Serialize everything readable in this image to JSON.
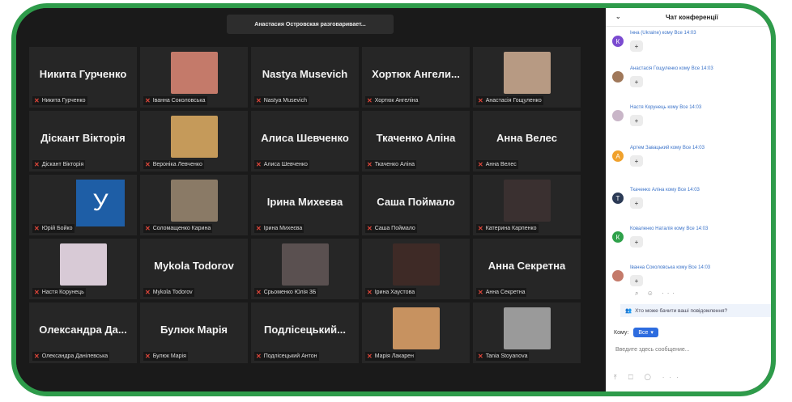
{
  "speaker_banner": "Анастасия Островская разговаривает...",
  "tiles": [
    {
      "big": "Никита Гурченко",
      "label": "Никита Гурченко",
      "type": "name"
    },
    {
      "big": "",
      "label": "Іванна Соколовська",
      "type": "photo",
      "color": "#c47a6a"
    },
    {
      "big": "Nastya Musevich",
      "label": "Nastya Musevich",
      "type": "name"
    },
    {
      "big": "Хортюк Ангели...",
      "label": "Хортюк Ангеліна",
      "type": "name"
    },
    {
      "big": "",
      "label": "Анастасія Гощуленко",
      "type": "photo",
      "color": "#b79a83"
    },
    {
      "big": "Діскант Вікторія",
      "label": "Діскант Вікторія",
      "type": "name"
    },
    {
      "big": "",
      "label": "Вероніка Левченко",
      "type": "photo",
      "color": "#c59a5a"
    },
    {
      "big": "Алиса Шевченко",
      "label": "Алиса Шевченко",
      "type": "name"
    },
    {
      "big": "Ткаченко Аліна",
      "label": "Ткаченко Аліна",
      "type": "name"
    },
    {
      "big": "Анна Велес",
      "label": "Анна Велес",
      "type": "name"
    },
    {
      "big": "",
      "label": "Юрій Бойко",
      "type": "avatar",
      "letter": "У"
    },
    {
      "big": "",
      "label": "Соломащенко Карина",
      "type": "photo",
      "color": "#8a7a66"
    },
    {
      "big": "Ірина Михеєва",
      "label": "Ірина Михеєва",
      "type": "name"
    },
    {
      "big": "Саша Поймало",
      "label": "Саша Поймало",
      "type": "name"
    },
    {
      "big": "",
      "label": "Катерина Карпенко",
      "type": "photo",
      "color": "#3a3030"
    },
    {
      "big": "",
      "label": "Настя Корунець",
      "type": "photo",
      "color": "#d8cad6"
    },
    {
      "big": "Mykola Todorov",
      "label": "Mykola Todorov",
      "type": "name"
    },
    {
      "big": "",
      "label": "Срьоменко Юлія 3Б",
      "type": "photo",
      "color": "#5a5050"
    },
    {
      "big": "",
      "label": "Ірина Хаустова",
      "type": "photo",
      "color": "#3e2a26"
    },
    {
      "big": "Анна Секретна",
      "label": "Анна Секретна",
      "type": "name"
    },
    {
      "big": "Олександра Да...",
      "label": "Олександра Данілевська",
      "type": "name"
    },
    {
      "big": "Булюк Марія",
      "label": "Булюк Марія",
      "type": "name"
    },
    {
      "big": "Подлісецький...",
      "label": "Подлісецький Антон",
      "type": "name"
    },
    {
      "big": "",
      "label": "Марія Лакарен",
      "type": "photo",
      "color": "#c79260"
    },
    {
      "big": "",
      "label": "Tania Stoyanova",
      "type": "photo",
      "color": "#9a9a9a"
    }
  ],
  "chat": {
    "title": "Чат конференції",
    "messages": [
      {
        "who": "Інна (Ukraine) кому Все 14:03",
        "avatar_color": "#7b4bd0",
        "avatar_letter": "К",
        "text": "+"
      },
      {
        "who": "Анастасія Гощуленко кому Все 14:03",
        "avatar_color": "#a0785a",
        "avatar_letter": "",
        "text": "+"
      },
      {
        "who": "Настя Корунець кому Все 14:03",
        "avatar_color": "#c9b6c8",
        "avatar_letter": "",
        "text": "+"
      },
      {
        "who": "Артем Завацький кому Все 14:03",
        "avatar_color": "#f0a12c",
        "avatar_letter": "А",
        "text": "+"
      },
      {
        "who": "Ткаченко Аліна кому Все 14:03",
        "avatar_color": "#2b3a55",
        "avatar_letter": "Т",
        "text": "+"
      },
      {
        "who": "Коваленко Наталія кому Все 14:03",
        "avatar_color": "#2ea14a",
        "avatar_letter": "К",
        "text": "+"
      },
      {
        "who": "Іванна Соколовська кому Все 14:03",
        "avatar_color": "#c47a6a",
        "avatar_letter": "",
        "text": "+"
      }
    ],
    "who_sees": "Хто може бачити ваші повідомлення?",
    "to_label": "Кому:",
    "to_value": "Все",
    "input_placeholder": "Введите здесь сообщение..."
  }
}
